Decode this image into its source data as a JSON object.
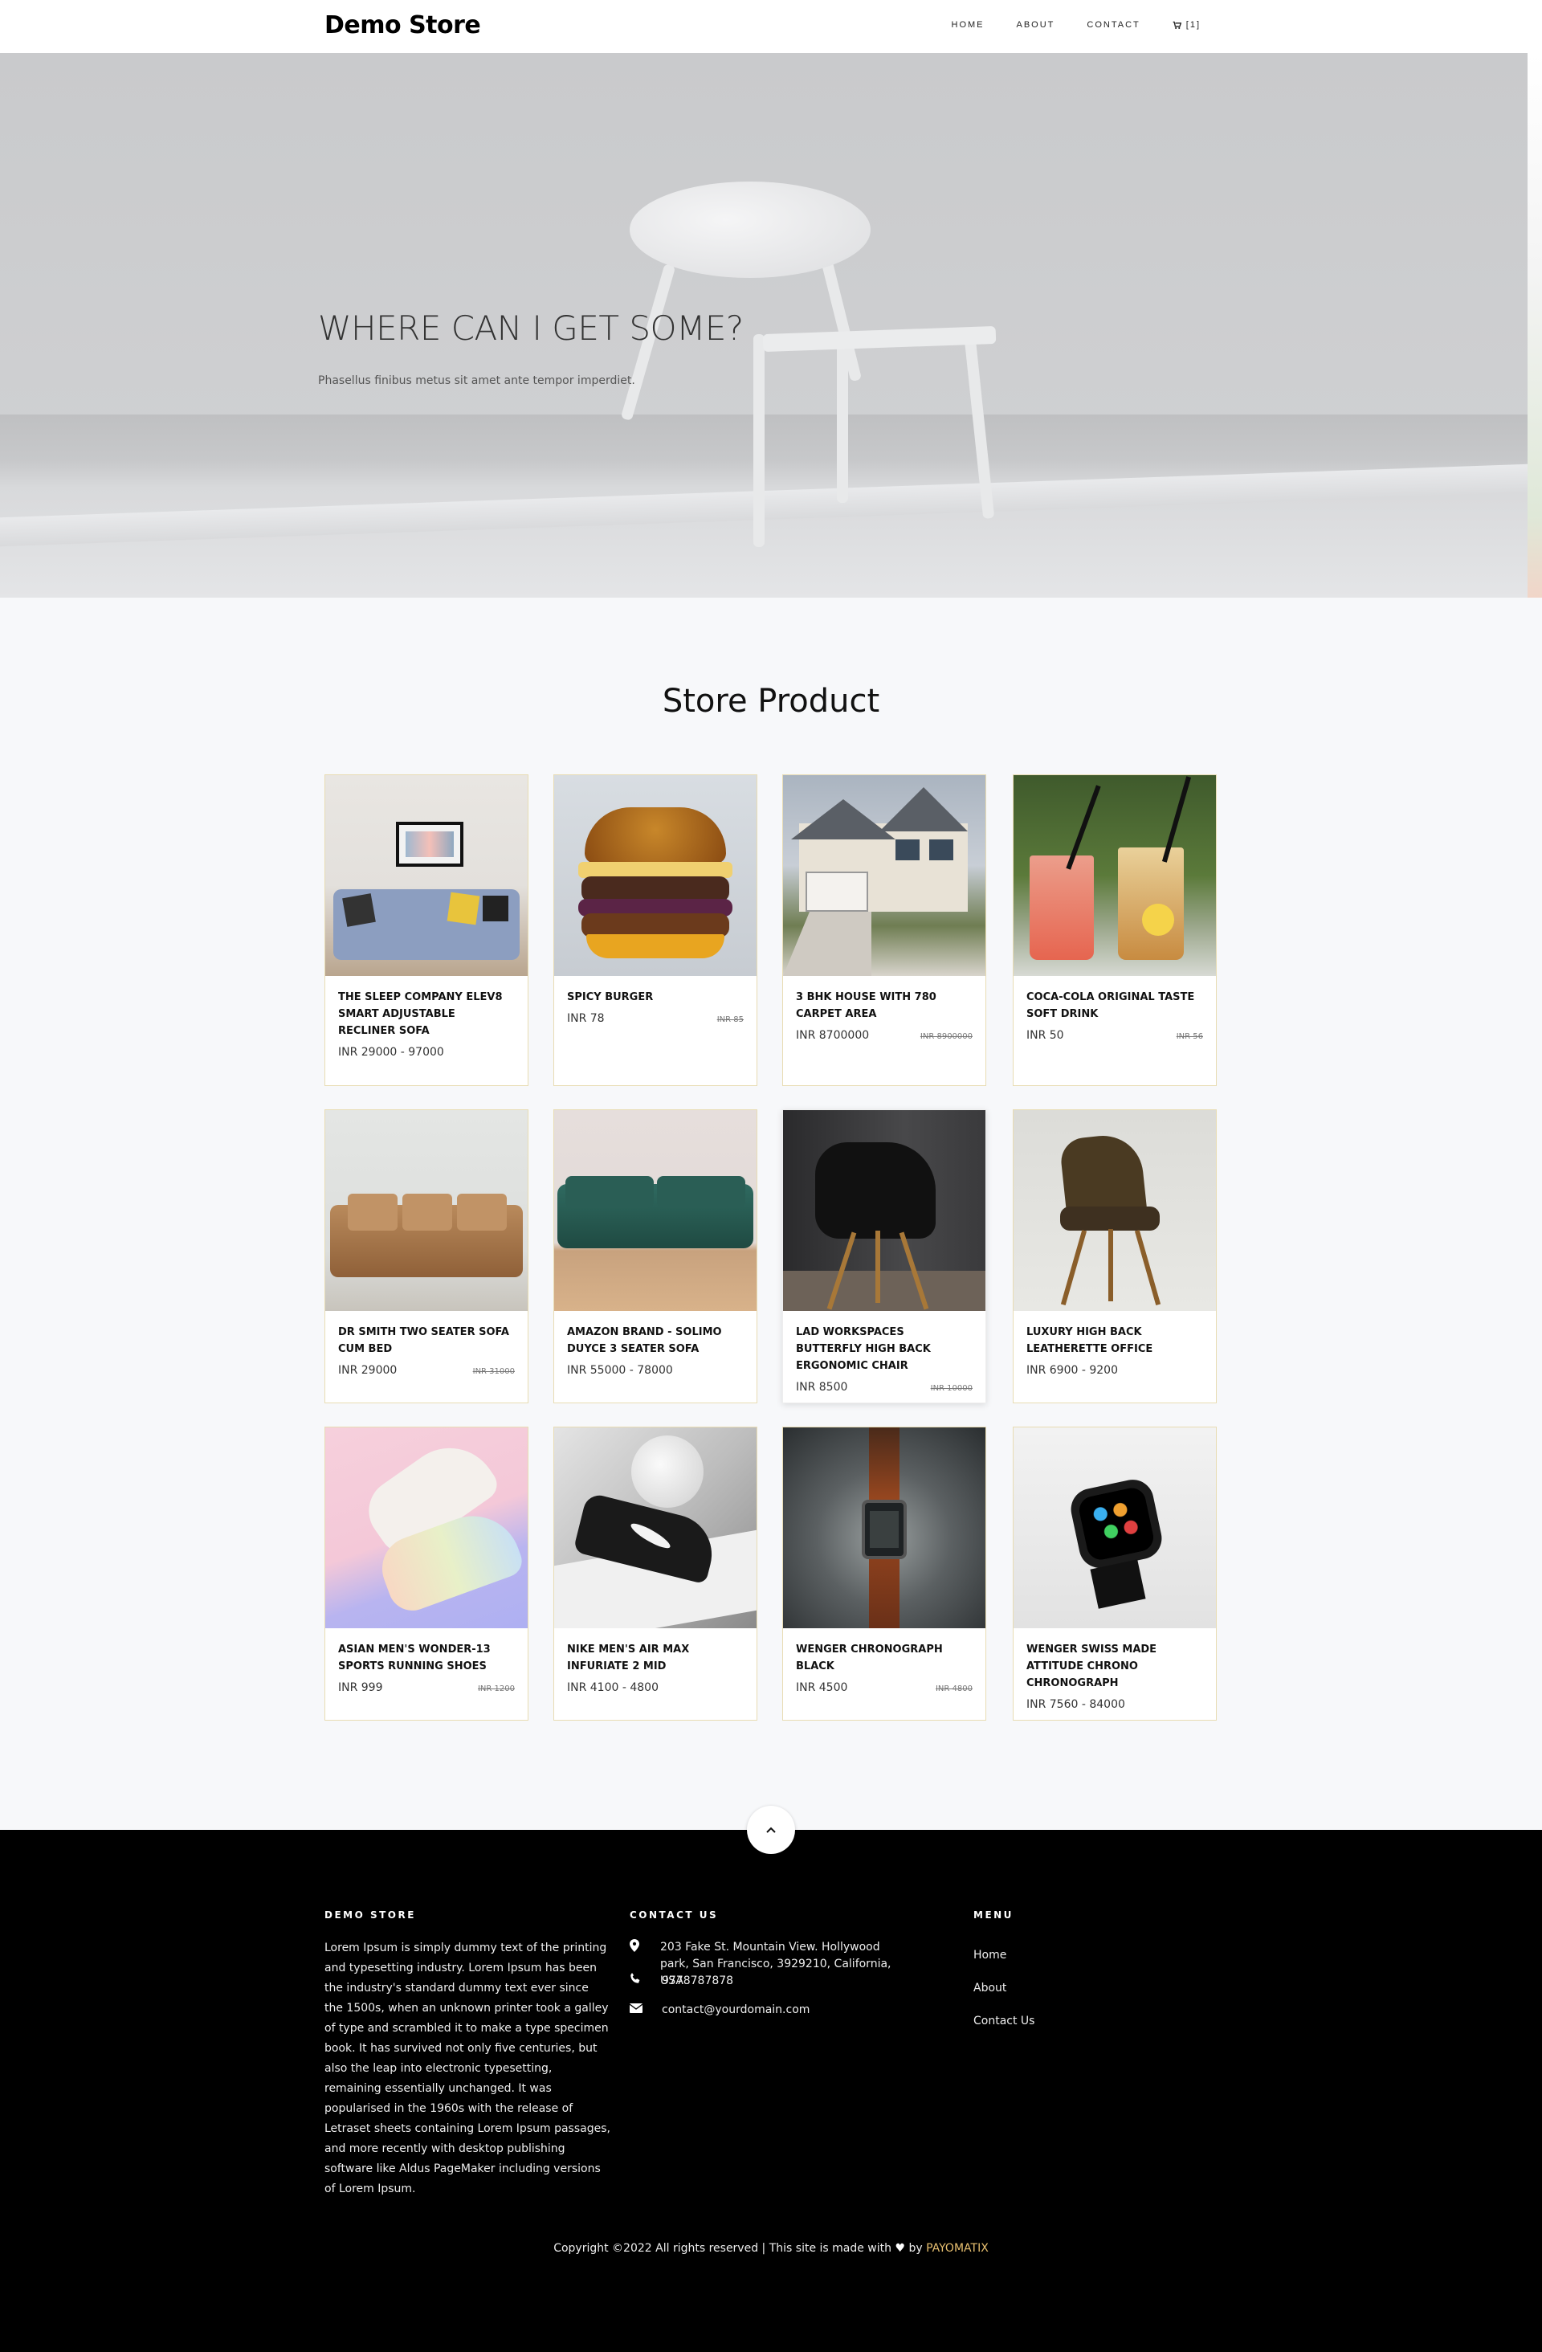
{
  "header": {
    "brand": "Demo Store",
    "nav": [
      "HOME",
      "ABOUT",
      "CONTACT"
    ],
    "cart_label": "[1]"
  },
  "hero": {
    "title": "WHERE CAN I GET SOME?",
    "subtitle": "Phasellus finibus metus sit amet ante tempor imperdiet."
  },
  "section_title": "Store Product",
  "products": [
    {
      "name": "THE SLEEP COMPANY ELEV8 SMART ADJUSTABLE RECLINER SOFA",
      "price": "INR 29000 - 97000",
      "old_price": ""
    },
    {
      "name": "SPICY BURGER",
      "price": "INR 78",
      "old_price": "INR 85"
    },
    {
      "name": "3 BHK HOUSE WITH 780 CARPET AREA",
      "price": "INR 8700000",
      "old_price": "INR 8900000"
    },
    {
      "name": "COCA-COLA ORIGINAL TASTE SOFT DRINK",
      "price": "INR 50",
      "old_price": "INR 56"
    },
    {
      "name": "DR SMITH TWO SEATER SOFA CUM BED",
      "price": "INR 29000",
      "old_price": "INR 31000"
    },
    {
      "name": "AMAZON BRAND - SOLIMO DUYCE 3 SEATER SOFA",
      "price": "INR 55000 - 78000",
      "old_price": ""
    },
    {
      "name": "LAD WORKSPACES BUTTERFLY HIGH BACK ERGONOMIC CHAIR",
      "price": "INR 8500",
      "old_price": "INR 10000"
    },
    {
      "name": "LUXURY HIGH BACK LEATHERETTE OFFICE",
      "price": "INR 6900 - 9200",
      "old_price": ""
    },
    {
      "name": "ASIAN MEN'S WONDER-13 SPORTS RUNNING SHOES",
      "price": "INR 999",
      "old_price": "INR 1200"
    },
    {
      "name": "NIKE MEN'S AIR MAX INFURIATE 2 MID",
      "price": "INR 4100 - 4800",
      "old_price": ""
    },
    {
      "name": "WENGER CHRONOGRAPH BLACK",
      "price": "INR 4500",
      "old_price": "INR 4800"
    },
    {
      "name": "WENGER SWISS MADE ATTITUDE CHRONO CHRONOGRAPH",
      "price": "INR 7560 - 84000",
      "old_price": ""
    }
  ],
  "footer": {
    "about_heading": "DEMO STORE",
    "about_text": "Lorem Ipsum is simply dummy text of the printing and typesetting industry. Lorem Ipsum has been the industry's standard dummy text ever since the 1500s, when an unknown printer took a galley of type and scrambled it to make a type specimen book. It has survived not only five centuries, but also the leap into electronic typesetting, remaining essentially unchanged. It was popularised in the 1960s with the release of Letraset sheets containing Lorem Ipsum passages, and more recently with desktop publishing software like Aldus PageMaker including versions of Lorem Ipsum.",
    "contact_heading": "CONTACT US",
    "address": "203 Fake St. Mountain View. Hollywood park, San Francisco, 3929210, California, USA",
    "phone": "9778787878",
    "email": "contact@yourdomain.com",
    "menu_heading": "MENU",
    "menu": [
      "Home",
      "About",
      "Contact Us"
    ],
    "copyright_prefix": "Copyright ©2022 All rights reserved | This site is made with",
    "copyright_by": "by",
    "copyright_brand": "PAYOMATIX"
  },
  "icons": {
    "cart": "cart-icon",
    "location": "map-pin-icon",
    "phone": "phone-icon",
    "email": "envelope-icon",
    "heart": "heart-icon",
    "to_top": "chevron-up-icon"
  },
  "colors": {
    "card_border": "#e8dcb3",
    "footer_bg": "#000000",
    "brand_link": "#e8c070"
  }
}
